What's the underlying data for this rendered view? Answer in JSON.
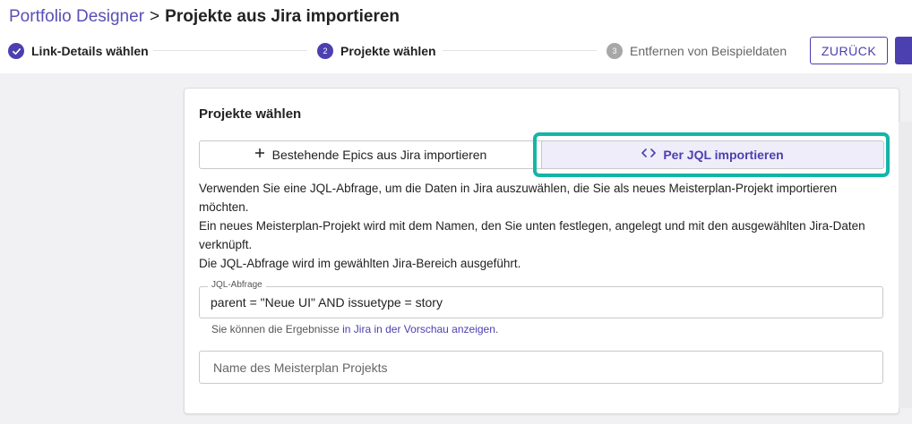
{
  "header": {
    "breadcrumb_link": "Portfolio Designer",
    "separator": ">",
    "title": "Projekte aus Jira importieren"
  },
  "stepper": {
    "steps": [
      {
        "number": "1",
        "label": "Link-Details wählen",
        "status": "done"
      },
      {
        "number": "2",
        "label": "Projekte wählen",
        "status": "active"
      },
      {
        "number": "3",
        "label": "Entfernen von Beispieldaten",
        "status": "pending"
      }
    ]
  },
  "actions": {
    "back_label": "ZURÜCK"
  },
  "card": {
    "title": "Projekte wählen",
    "toggle": {
      "epics_label": "Bestehende Epics aus Jira importieren",
      "epics_icon": "plus-icon",
      "jql_label": "Per JQL importieren",
      "jql_icon": "code-icon",
      "selected": "jql"
    },
    "description": [
      "Verwenden Sie eine JQL-Abfrage, um die Daten in Jira auszuwählen, die Sie als neues Meisterplan-Projekt importieren möchten.",
      "Ein neues Meisterplan-Projekt wird mit dem Namen, den Sie unten festlegen, angelegt und mit den ausgewählten Jira-Daten verknüpft.",
      "Die JQL-Abfrage wird im gewählten Jira-Bereich ausgeführt."
    ],
    "jql_field": {
      "label": "JQL-Abfrage",
      "value": "parent = \"Neue UI\" AND issuetype = story"
    },
    "helper": {
      "prefix": "Sie können die Ergebnisse ",
      "link": "in Jira in der Vorschau anzeigen",
      "suffix": "."
    },
    "name_field": {
      "placeholder": "Name des Meisterplan Projekts",
      "value": ""
    }
  },
  "colors": {
    "accent": "#4c3fb0",
    "highlight": "#14b5a6",
    "pending_step": "#a7a7a7",
    "background": "#f1f1f3"
  }
}
